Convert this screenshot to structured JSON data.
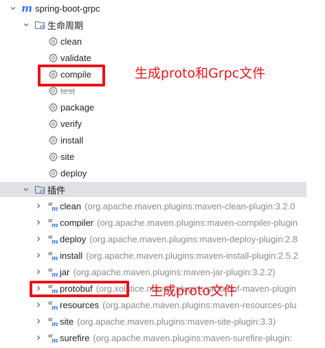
{
  "project": {
    "name": "spring-boot-grpc"
  },
  "lifecycle": {
    "label": "生命周期",
    "items": [
      {
        "label": "clean",
        "disabled": false
      },
      {
        "label": "validate",
        "disabled": false
      },
      {
        "label": "compile",
        "disabled": false
      },
      {
        "label": "test",
        "disabled": true
      },
      {
        "label": "package",
        "disabled": false
      },
      {
        "label": "verify",
        "disabled": false
      },
      {
        "label": "install",
        "disabled": false
      },
      {
        "label": "site",
        "disabled": false
      },
      {
        "label": "deploy",
        "disabled": false
      }
    ]
  },
  "plugins": {
    "label": "插件",
    "items": [
      {
        "name": "clean",
        "coords": "(org.apache.maven.plugins:maven-clean-plugin:3.2.0"
      },
      {
        "name": "compiler",
        "coords": "(org.apache.maven.plugins:maven-compiler-plugin"
      },
      {
        "name": "deploy",
        "coords": "(org.apache.maven.plugins:maven-deploy-plugin:2.8"
      },
      {
        "name": "install",
        "coords": "(org.apache.maven.plugins:maven-install-plugin:2.5.2"
      },
      {
        "name": "jar",
        "coords": "(org.apache.maven.plugins:maven-jar-plugin:3.2.2)"
      },
      {
        "name": "protobuf",
        "coords": "(org.xolstice.maven.plugins:protobuf-maven-plugin"
      },
      {
        "name": "resources",
        "coords": "(org.apache.maven.plugins:maven-resources-plu"
      },
      {
        "name": "site",
        "coords": "(org.apache.maven.plugins:maven-site-plugin:3.3)"
      },
      {
        "name": "surefire",
        "coords": "(org.apache.maven.plugins:maven-surefire-plugin:"
      }
    ]
  },
  "annotations": {
    "compile_note": "生成proto和Grpc文件",
    "protobuf_note": "生成proto文件"
  },
  "colors": {
    "accent": "#3573f0",
    "annotation": "#e8131b",
    "selection": "#dfe1e5"
  }
}
